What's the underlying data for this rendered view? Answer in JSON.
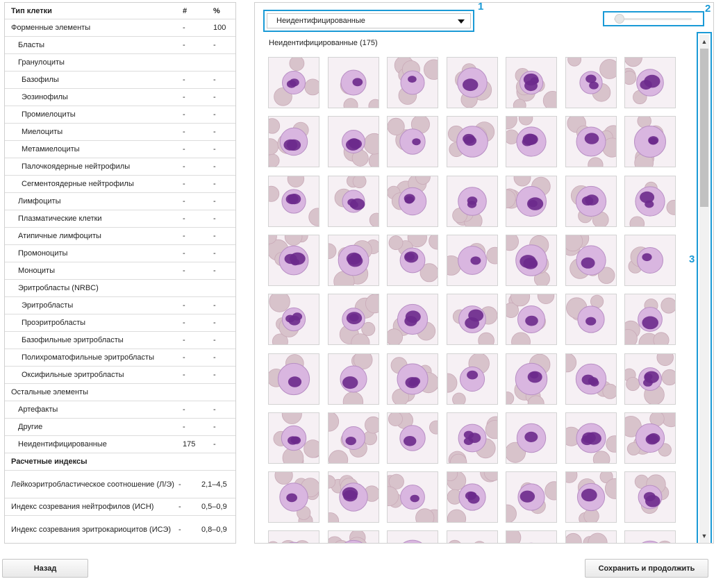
{
  "table": {
    "header": {
      "name": "Тип клетки",
      "num": "#",
      "pct": "%"
    },
    "rows": [
      {
        "name": "Форменные элементы",
        "num": "-",
        "pct": "100",
        "level": 0
      },
      {
        "name": "Бласты",
        "num": "-",
        "pct": "-",
        "level": 1
      },
      {
        "name": "Гранулоциты",
        "num": "",
        "pct": "",
        "level": 1
      },
      {
        "name": "Базофилы",
        "num": "-",
        "pct": "-",
        "level": 2
      },
      {
        "name": "Эозинофилы",
        "num": "-",
        "pct": "-",
        "level": 2
      },
      {
        "name": "Промиелоциты",
        "num": "-",
        "pct": "-",
        "level": 2
      },
      {
        "name": "Миелоциты",
        "num": "-",
        "pct": "-",
        "level": 2
      },
      {
        "name": "Метамиелоциты",
        "num": "-",
        "pct": "-",
        "level": 2
      },
      {
        "name": "Палочкоядерные нейтрофилы",
        "num": "-",
        "pct": "-",
        "level": 2
      },
      {
        "name": "Сегментоядерные нейтрофилы",
        "num": "-",
        "pct": "-",
        "level": 2
      },
      {
        "name": "Лимфоциты",
        "num": "-",
        "pct": "-",
        "level": 1
      },
      {
        "name": "Плазматические клетки",
        "num": "-",
        "pct": "-",
        "level": 1
      },
      {
        "name": "Атипичные лимфоциты",
        "num": "-",
        "pct": "-",
        "level": 1
      },
      {
        "name": "Промоноциты",
        "num": "-",
        "pct": "-",
        "level": 1
      },
      {
        "name": "Моноциты",
        "num": "-",
        "pct": "-",
        "level": 1
      },
      {
        "name": "Эритробласты (NRBC)",
        "num": "",
        "pct": "",
        "level": 1
      },
      {
        "name": "Эритробласты",
        "num": "-",
        "pct": "-",
        "level": 2
      },
      {
        "name": "Проэритробласты",
        "num": "-",
        "pct": "-",
        "level": 2
      },
      {
        "name": "Базофильные эритробласты",
        "num": "-",
        "pct": "-",
        "level": 2
      },
      {
        "name": "Полихроматофильные эритробласты",
        "num": "-",
        "pct": "-",
        "level": 2
      },
      {
        "name": "Оксифильные эритробласты",
        "num": "-",
        "pct": "-",
        "level": 2
      },
      {
        "name": "Остальные элементы",
        "num": "",
        "pct": "",
        "level": 0
      },
      {
        "name": "Артефакты",
        "num": "-",
        "pct": "-",
        "level": 1
      },
      {
        "name": "Другие",
        "num": "-",
        "pct": "-",
        "level": 1
      },
      {
        "name": "Неидентифицированные",
        "num": "175",
        "pct": "-",
        "level": 1
      }
    ],
    "indices_title": "Расчетные индексы",
    "indices": [
      {
        "name": "Лейкоэритробластическое соотношение (Л/Э)",
        "num": "-",
        "pct": "2,1–4,5",
        "tall": true
      },
      {
        "name": "Индекс созревания нейтрофилов (ИСН)",
        "num": "-",
        "pct": "0,5–0,9",
        "tall": false
      },
      {
        "name": "Индекс созревания эритрокариоцитов (ИСЭ)",
        "num": "-",
        "pct": "0,8–0,9",
        "tall": true
      }
    ]
  },
  "gallery": {
    "dropdown_value": "Неидентифицированные",
    "section_title": "Неидентифицированные (175)",
    "callouts": [
      "1",
      "2",
      "3"
    ],
    "slider_level": 0.05,
    "scroll_position": 0.0,
    "colors": {
      "accent": "#1a9ad6",
      "rbc": "#d8c3cb",
      "nucleus": "#6b2a8c",
      "cytoplasm": "#d9b6e0"
    }
  },
  "buttons": {
    "back": "Назад",
    "save": "Сохранить и продолжить"
  },
  "icons": {
    "dropdown": "caret-down-icon",
    "scroll_up": "chevron-up-icon",
    "scroll_down": "chevron-down-icon"
  }
}
